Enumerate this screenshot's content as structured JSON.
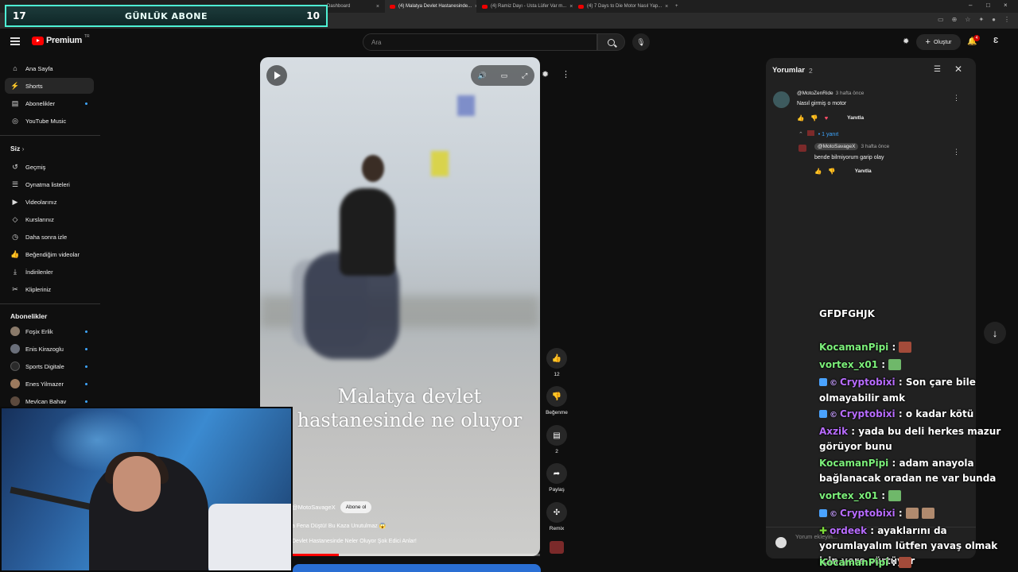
{
  "browser": {
    "tabs": [
      {
        "label": "Dashboard"
      },
      {
        "label": "(4) Malatya Devlet Hastanesinde..."
      },
      {
        "label": "(4) Ramiz Dayı - Usta Lüfer Var m..."
      },
      {
        "label": "(4) 7 Days to Die Motor Nasıl Yap..."
      }
    ]
  },
  "overlay_counter": {
    "left": "17",
    "title": "GÜNLÜK ABONE",
    "right": "10"
  },
  "masthead": {
    "logo": "Premium",
    "region": "TR",
    "search_placeholder": "Ara",
    "create_label": "Oluştur",
    "notifications": "4"
  },
  "sidebar": {
    "main": [
      {
        "label": "Ana Sayfa",
        "icon": "home-icon"
      },
      {
        "label": "Shorts",
        "icon": "shorts-icon"
      },
      {
        "label": "Abonelikler",
        "icon": "subscriptions-icon"
      },
      {
        "label": "YouTube Music",
        "icon": "music-icon"
      }
    ],
    "you_heading": "Siz",
    "you": [
      {
        "label": "Geçmiş"
      },
      {
        "label": "Oynatma listeleri"
      },
      {
        "label": "Videolarınız"
      },
      {
        "label": "Kurslarınız"
      },
      {
        "label": "Daha sonra izle"
      },
      {
        "label": "Beğendiğim videolar"
      },
      {
        "label": "İndirilenler"
      },
      {
        "label": "Klipleriniz"
      }
    ],
    "subs_heading": "Abonelikler",
    "subs": [
      {
        "label": "Foşix Erlik"
      },
      {
        "label": "Enis Kirazoglu"
      },
      {
        "label": "Sports Digitale"
      },
      {
        "label": "Enes Yilmazer"
      },
      {
        "label": "Mevlcan Bahav"
      }
    ]
  },
  "player": {
    "overlay_text_1": "Malatya devlet",
    "overlay_text_2": "hastanesinde ne oluyor",
    "channel": "@MotoSavageX",
    "subscribe": "Abone ol",
    "line1": "a Fena Düştü! Bu Kaza Unutulmaz 😱",
    "line2": "Devlet Hastanesinde Neler Oluyor Şok Edici Anlar!",
    "progress": 0.19
  },
  "actions": {
    "likes": "12",
    "dislike": "Beğenme",
    "comments": "2",
    "share": "Paylaş",
    "remix": "Remix"
  },
  "comments": {
    "title": "Yorumlar",
    "count": "2",
    "items": [
      {
        "user": "@MotoZenRide",
        "time": "3 hafta önce",
        "text": "Nasıl girmiş o motor",
        "reply": "Yanıtla"
      }
    ],
    "replies_toggle": "1 yanıt",
    "reply": {
      "user": "@MotoSavageX",
      "time": "3 hafta önce",
      "text": "bende bilmiyorum garip olay",
      "reply": "Yanıtla"
    },
    "add_placeholder": "Yorum ekleyin..."
  },
  "chat": {
    "lines": [
      {
        "name": "",
        "text": "GFDFGHJK"
      },
      {
        "name": "KocamanPipi",
        "text": " :"
      },
      {
        "name": "vortex_x01",
        "text": " :"
      },
      {
        "name": "Cryptobixi",
        "text": " : Son çare bile olmayabilir amk"
      },
      {
        "name": "Cryptobixi",
        "text": " : o kadar kötü"
      },
      {
        "name": "Axzik",
        "text": " : yada bu deli herkes mazur görüyor bunu"
      },
      {
        "name": "KocamanPipi",
        "text": " : adam anayola bağlanacak oradan ne var bunda"
      },
      {
        "name": "vortex_x01",
        "text": " :"
      },
      {
        "name": "Cryptobixi",
        "text": " :"
      },
      {
        "name": "ordeek",
        "text": " : ayaklarını da yorumlayalım lütfen yavaş olmak için yere sürtüyor"
      },
      {
        "name": "KocamanPipi",
        "text": " :"
      }
    ],
    "colors": {
      "green": "#7cf07a",
      "purple": "#b86cff",
      "white": "#ffffff"
    }
  }
}
